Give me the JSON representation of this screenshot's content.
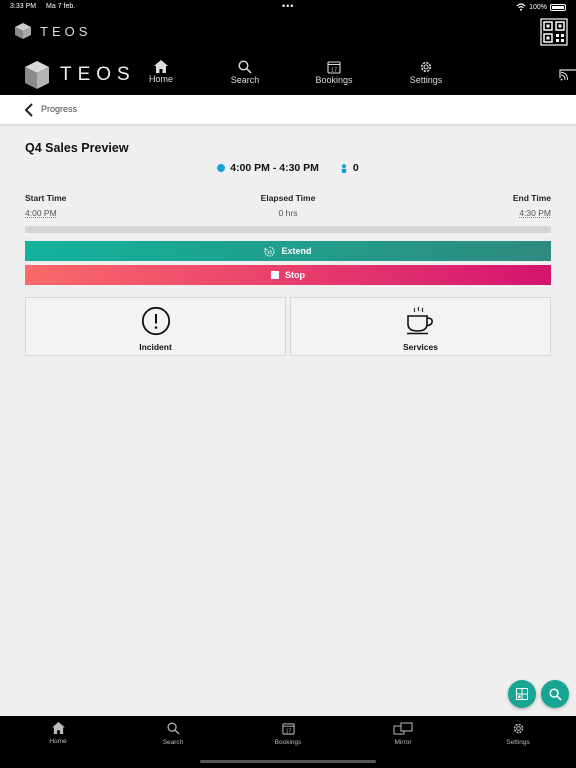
{
  "status_bar": {
    "time": "3:33 PM",
    "date": "Ma 7 feb.",
    "dots": "•••",
    "battery": "100%"
  },
  "brand": {
    "name": "TEOS"
  },
  "nav": {
    "items": [
      {
        "label": "Home",
        "icon": "home-icon"
      },
      {
        "label": "Search",
        "icon": "search-icon"
      },
      {
        "label": "Bookings",
        "icon": "calendar-icon"
      },
      {
        "label": "Settings",
        "icon": "gear-icon"
      }
    ],
    "calendar_day": "17"
  },
  "breadcrumb": {
    "label": "Progress"
  },
  "meeting": {
    "title": "Q4 Sales Preview",
    "time_range": "4:00 PM - 4:30 PM",
    "attendees": "0",
    "start_label": "Start Time",
    "start_value": "4:00 PM",
    "elapsed_label": "Elapsed Time",
    "elapsed_value": "0 hrs",
    "end_label": "End Time",
    "end_value": "4:30 PM",
    "progress": 0
  },
  "actions": {
    "extend": "Extend",
    "stop": "Stop"
  },
  "tiles": {
    "incident": "Incident",
    "services": "Services"
  },
  "tabbar": {
    "items": [
      {
        "label": "Home",
        "icon": "home-icon"
      },
      {
        "label": "Search",
        "icon": "search-icon"
      },
      {
        "label": "Bookings",
        "icon": "calendar-icon"
      },
      {
        "label": "Mirror",
        "icon": "mirror-icon"
      },
      {
        "label": "Settings",
        "icon": "gear-icon"
      }
    ]
  },
  "colors": {
    "accent_teal": "#16a693",
    "stop_start": "#fb6a6a",
    "stop_end": "#d4146f",
    "info_blue": "#1a9ed8"
  }
}
